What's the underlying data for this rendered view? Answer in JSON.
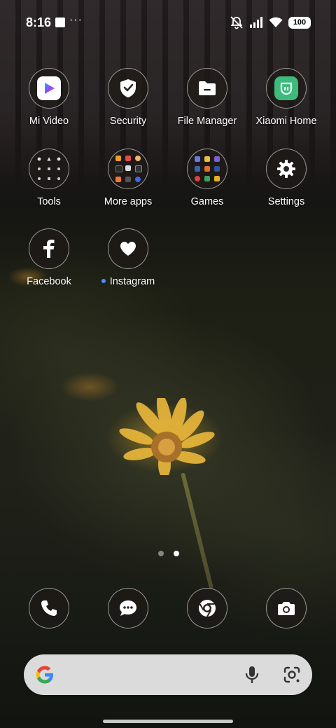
{
  "status_bar": {
    "time": "8:16",
    "more": "···",
    "battery": "100",
    "icons": [
      "notification-square-icon",
      "silent-bell-icon",
      "signal-icon",
      "wifi-icon",
      "battery-icon"
    ]
  },
  "apps": [
    {
      "label": "Mi Video",
      "icon": "play-icon"
    },
    {
      "label": "Security",
      "icon": "shield-icon"
    },
    {
      "label": "File Manager",
      "icon": "folder-icon"
    },
    {
      "label": "Xiaomi Home",
      "icon": "mi-home-icon"
    },
    {
      "label": "Tools",
      "icon": "folder-icon"
    },
    {
      "label": "More apps",
      "icon": "folder-icon"
    },
    {
      "label": "Games",
      "icon": "folder-icon"
    },
    {
      "label": "Settings",
      "icon": "gear-icon"
    },
    {
      "label": "Facebook",
      "icon": "facebook-icon"
    },
    {
      "label": "Instagram",
      "icon": "heart-icon",
      "new": true
    }
  ],
  "page_indicator": {
    "pages": 2,
    "active": 2
  },
  "dock": [
    {
      "name": "phone",
      "icon": "phone-icon"
    },
    {
      "name": "messages",
      "icon": "chat-bubble-icon"
    },
    {
      "name": "browser",
      "icon": "chrome-icon"
    },
    {
      "name": "camera",
      "icon": "camera-icon"
    }
  ],
  "search_bar": {
    "icons": [
      "google-g-icon",
      "microphone-icon",
      "lens-icon"
    ]
  },
  "colors": {
    "accent_dot": "#4d8dff",
    "xiaomi_home_green": "#3dbb7a"
  }
}
